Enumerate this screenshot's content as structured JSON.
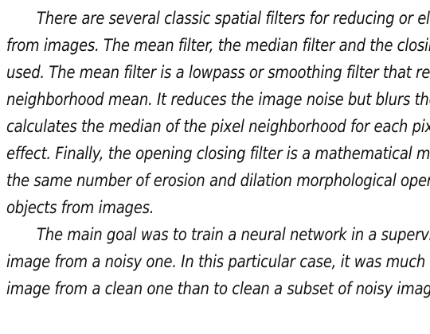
{
  "document": {
    "paragraphs": [
      {
        "lines": [
          "There are several classic spatial filters for reducing or elimin",
          "from images.  The mean filter, the median filter and the closing o",
          "used.  The mean filter is a lowpass or smoothing filter that replace",
          "neighborhood mean.  It reduces the image noise but blurs the imag",
          "calculates the median of the pixel neighborhood for each pixel, th",
          "effect.  Finally, the opening closing filter is a mathematical morpho",
          "the same number of erosion and dilation morphological operations",
          "objects from images."
        ]
      },
      {
        "lines": [
          "The main goal was to train a neural network in a supervised",
          "image from a noisy one.  In this particular case, it was much easier",
          "image from a clean one than to clean a subset of noisy images."
        ]
      }
    ]
  }
}
